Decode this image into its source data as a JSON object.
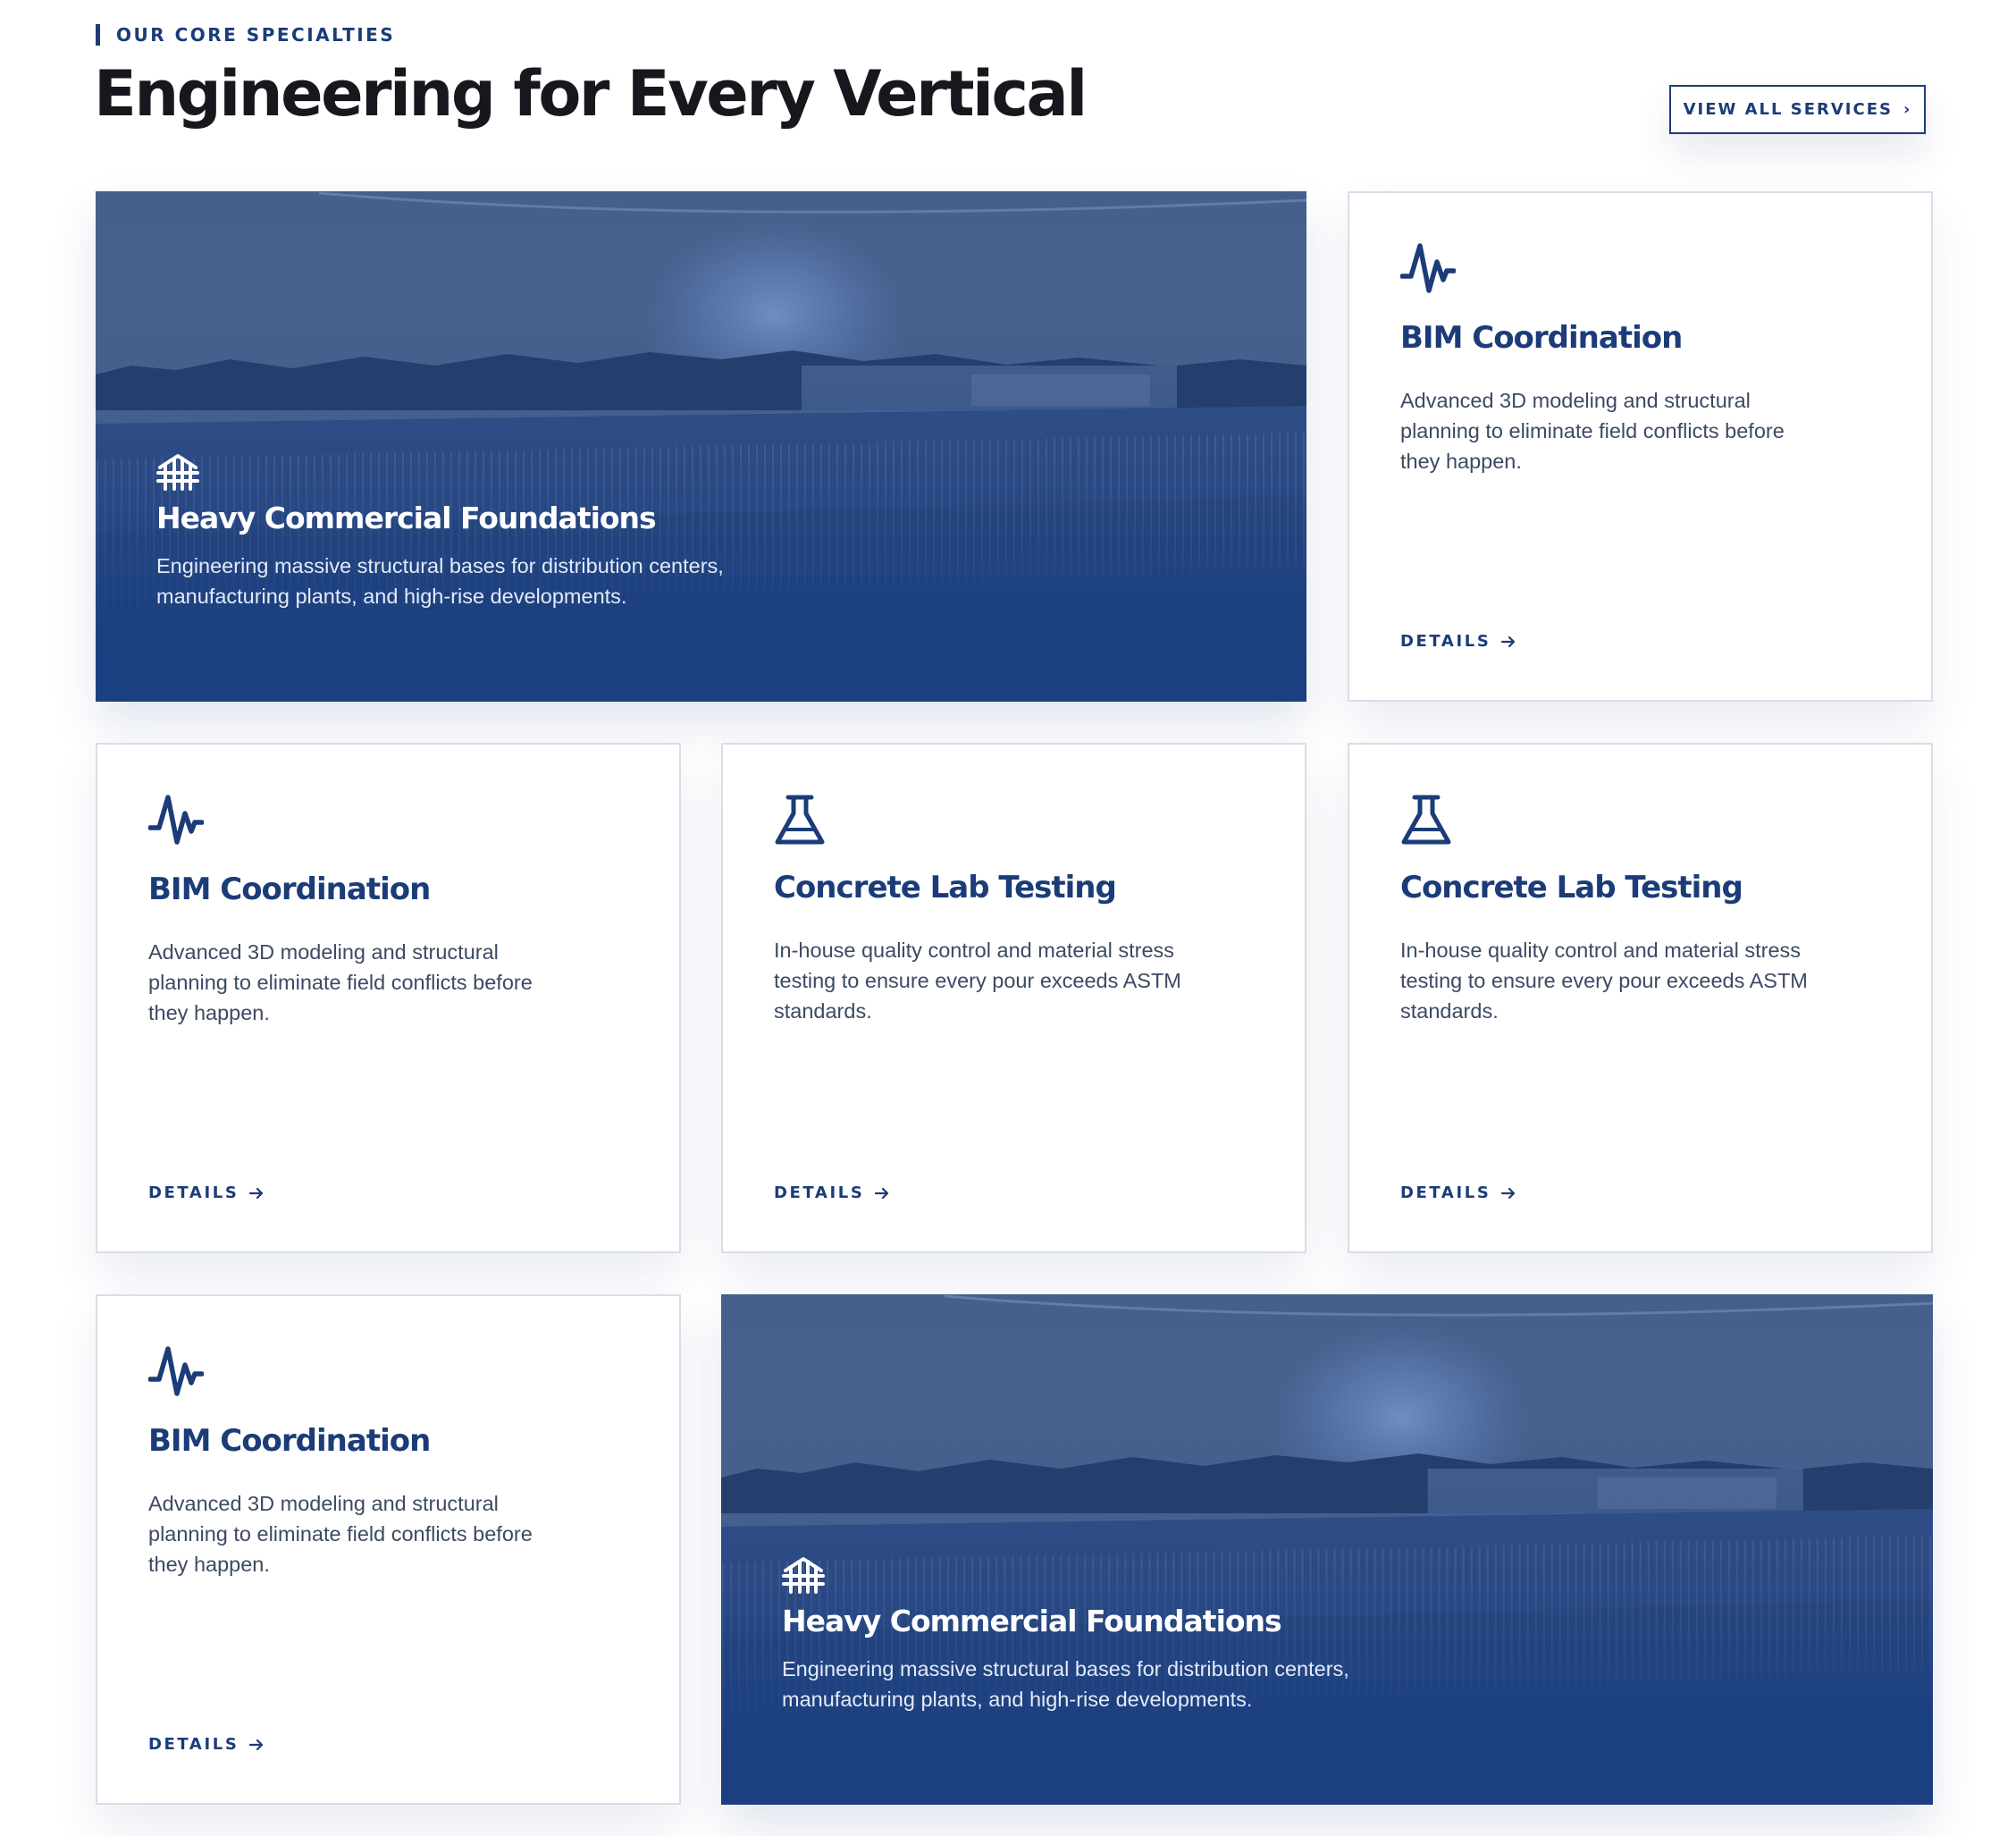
{
  "section": {
    "eyebrow": "OUR CORE SPECIALTIES",
    "headline": "Engineering for Every Vertical",
    "view_all_label": "VIEW ALL SERVICES"
  },
  "colors": {
    "brand_navy": "#1b3c78",
    "feature_overlay": "#1b3f80",
    "heading": "#16181d",
    "body_text": "#3c4a63",
    "card_border": "#d9dde7"
  },
  "cards": [
    {
      "icon": "pulse-icon",
      "title": "Heavy Commercial Foundations",
      "desc": "Engineering massive structural bases for distribution centers, manufacturing plants, and high-rise developments.",
      "style": "feature"
    },
    {
      "icon": "pulse-icon",
      "title": "BIM Coordination",
      "desc": "Advanced 3D modeling and structural planning to eliminate field conflicts before they happen.",
      "details_label": "DETAILS"
    },
    {
      "icon": "pulse-icon",
      "title": "BIM Coordination",
      "desc": "Advanced 3D modeling and structural planning to eliminate field conflicts before they happen.",
      "details_label": "DETAILS"
    },
    {
      "icon": "flask-icon",
      "title": "Concrete Lab Testing",
      "desc": "In-house quality control and material stress testing to ensure every pour exceeds ASTM standards.",
      "details_label": "DETAILS"
    },
    {
      "icon": "flask-icon",
      "title": "Concrete Lab Testing",
      "desc": "In-house quality control and material stress testing to ensure every pour exceeds ASTM standards.",
      "details_label": "DETAILS"
    },
    {
      "icon": "pulse-icon",
      "title": "BIM Coordination",
      "desc": "Advanced 3D modeling and structural planning to eliminate field conflicts before they happen.",
      "details_label": "DETAILS"
    },
    {
      "icon": "foundation-icon",
      "title": "Heavy Commercial Foundations",
      "desc": "Engineering massive structural bases for distribution centers, manufacturing plants, and high-rise developments.",
      "style": "feature"
    }
  ]
}
